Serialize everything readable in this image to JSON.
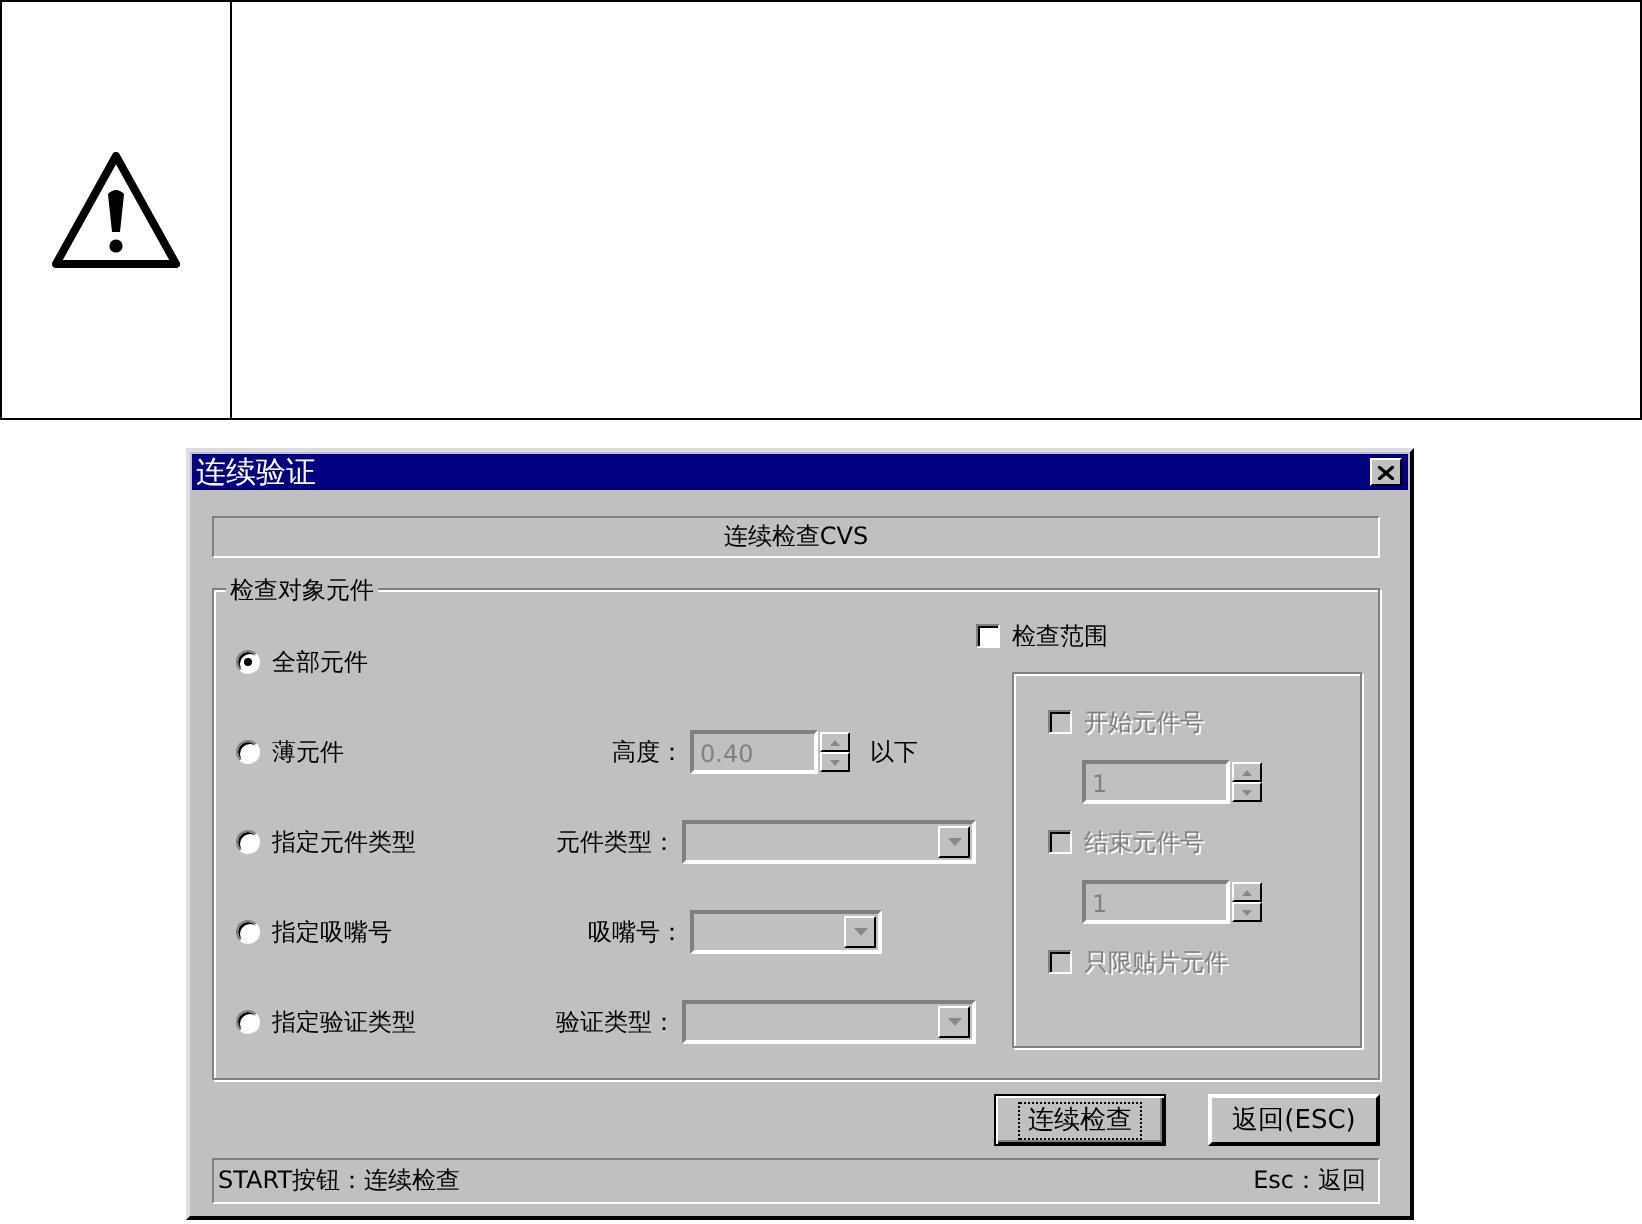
{
  "window": {
    "title": "连续验证"
  },
  "header": "连续检查CVS",
  "group": {
    "title": "检查对象元件",
    "options": [
      {
        "label": "全部元件",
        "selected": true
      },
      {
        "label": "薄元件",
        "selected": false,
        "field": {
          "kind": "spin",
          "label": "高度：",
          "value": "0.40",
          "suffix": "以下",
          "disabled": true
        }
      },
      {
        "label": "指定元件类型",
        "selected": false,
        "field": {
          "kind": "combo",
          "label": "元件类型：",
          "disabled": true
        }
      },
      {
        "label": "指定吸嘴号",
        "selected": false,
        "field": {
          "kind": "minicombo",
          "label": "吸嘴号：",
          "disabled": true
        }
      },
      {
        "label": "指定验证类型",
        "selected": false,
        "field": {
          "kind": "combo",
          "label": "验证类型：",
          "disabled": true
        }
      }
    ]
  },
  "range": {
    "label": "检查范围",
    "checked": false,
    "items": [
      {
        "kind": "checkbox",
        "label": "开始元件号",
        "checked": false,
        "disabled": true
      },
      {
        "kind": "spin",
        "value": "1",
        "disabled": true
      },
      {
        "kind": "checkbox",
        "label": "结束元件号",
        "checked": false,
        "disabled": true
      },
      {
        "kind": "spin",
        "value": "1",
        "disabled": true
      },
      {
        "kind": "checkbox",
        "label": "只限贴片元件",
        "checked": false,
        "disabled": true
      }
    ]
  },
  "buttons": [
    {
      "label": "连续检查",
      "focused": true
    },
    {
      "label": "返回(ESC)",
      "focused": false
    }
  ],
  "status_bar": {
    "left": "START按钮：连续检查",
    "right": "Esc：返回"
  }
}
